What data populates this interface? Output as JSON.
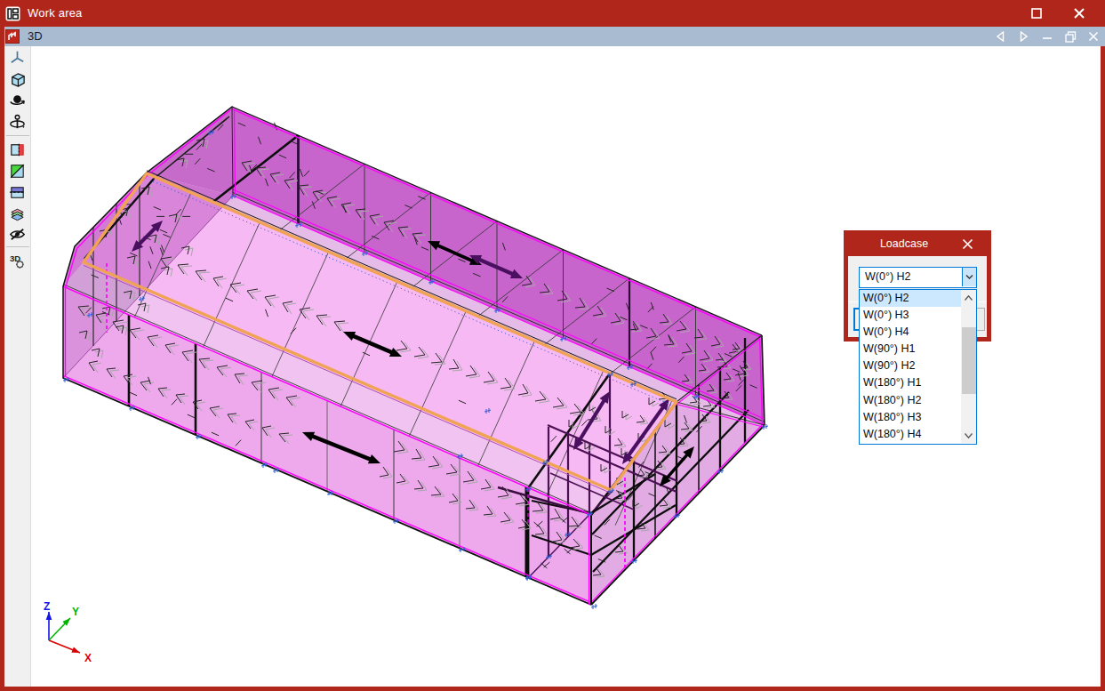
{
  "window": {
    "title": "Work area"
  },
  "titlebar": {
    "maximize": "maximize",
    "close": "close"
  },
  "tabbar": {
    "tab_label": "3D"
  },
  "toolbar": {
    "icons": [
      "axes-tripod",
      "iso-cube",
      "orbit-view",
      "rotate-view",
      "section-view",
      "shading-toggle",
      "clip-plane",
      "layers",
      "hide-object",
      "3d-settings"
    ]
  },
  "dialog": {
    "title": "Loadcase",
    "combo_value": "W(0°) H2",
    "items": [
      "W(0°) H2",
      "W(0°) H3",
      "W(0°) H4",
      "W(90°) H1",
      "W(90°) H2",
      "W(180°) H1",
      "W(180°) H2",
      "W(180°) H3",
      "W(180°) H4"
    ],
    "selected_index": 0
  },
  "axes": {
    "x": "X",
    "y": "Y",
    "z": "Z"
  },
  "colors": {
    "accent_red": "#B1261B",
    "highlight_orange": "#f2a65a",
    "selection_blue": "#cce8ff",
    "combo_border": "#0078d7"
  }
}
